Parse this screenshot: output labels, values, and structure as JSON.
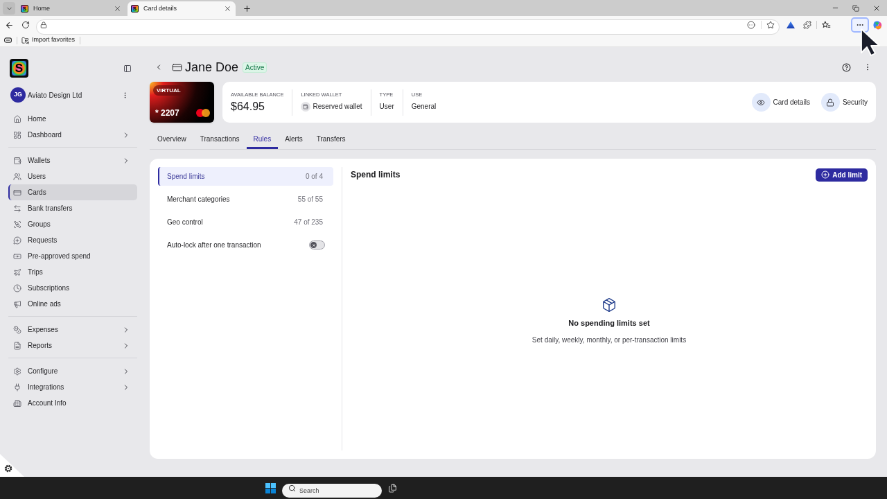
{
  "browser": {
    "tabs": [
      {
        "favicon": "S",
        "title": "Home",
        "selected": false
      },
      {
        "favicon": "S",
        "title": "Card details",
        "selected": true
      }
    ],
    "menu_button": {
      "highlighted": true
    },
    "favorites_bar": [
      {
        "label": "Import favorites"
      }
    ]
  },
  "sidebar": {
    "logo": "S",
    "account": {
      "initials": "JG",
      "name": "Aviato Design Ltd"
    },
    "groups": [
      {
        "items": [
          {
            "label": "Home",
            "selected": false,
            "has_submenu": false
          },
          {
            "label": "Dashboard",
            "selected": false,
            "has_submenu": true
          }
        ]
      },
      {
        "items": [
          {
            "label": "Wallets",
            "selected": false,
            "has_submenu": true
          },
          {
            "label": "Users",
            "selected": false,
            "has_submenu": false
          },
          {
            "label": "Cards",
            "selected": true,
            "has_submenu": false
          },
          {
            "label": "Bank transfers",
            "selected": false,
            "has_submenu": false
          },
          {
            "label": "Groups",
            "selected": false,
            "has_submenu": false
          },
          {
            "label": "Requests",
            "selected": false,
            "has_submenu": false
          },
          {
            "label": "Pre-approved spend",
            "selected": false,
            "has_submenu": false
          },
          {
            "label": "Trips",
            "selected": false,
            "has_submenu": false
          },
          {
            "label": "Subscriptions",
            "selected": false,
            "has_submenu": false
          },
          {
            "label": "Online ads",
            "selected": false,
            "has_submenu": false
          }
        ]
      },
      {
        "items": [
          {
            "label": "Expenses",
            "selected": false,
            "has_submenu": true
          },
          {
            "label": "Reports",
            "selected": false,
            "has_submenu": true
          }
        ]
      },
      {
        "items": [
          {
            "label": "Configure",
            "selected": false,
            "has_submenu": true
          },
          {
            "label": "Integrations",
            "selected": false,
            "has_submenu": true
          },
          {
            "label": "Account Info",
            "selected": false,
            "has_submenu": false
          }
        ]
      }
    ]
  },
  "header": {
    "title": "Jane Doe",
    "status": "Active"
  },
  "card": {
    "badge": "VIRTUAL",
    "number": "* 2207"
  },
  "summary": {
    "fields": [
      {
        "kind": "amount",
        "label": "AVAILABLE BALANCE",
        "value": "$64.95"
      },
      {
        "kind": "wallet",
        "label": "LINKED WALLET",
        "value": "Reserved wallet"
      },
      {
        "kind": "text",
        "label": "TYPE",
        "value": "User"
      },
      {
        "kind": "text",
        "label": "USE",
        "value": "General"
      }
    ],
    "actions": [
      {
        "label": "Card details"
      },
      {
        "label": "Security"
      }
    ]
  },
  "tabs": [
    {
      "label": "Overview",
      "selected": false
    },
    {
      "label": "Transactions",
      "selected": false
    },
    {
      "label": "Rules",
      "selected": true
    },
    {
      "label": "Alerts",
      "selected": false
    },
    {
      "label": "Transfers",
      "selected": false
    }
  ],
  "rules": {
    "items": [
      {
        "kind": "link",
        "label": "Spend limits",
        "count": "0 of 4",
        "selected": true
      },
      {
        "kind": "link",
        "label": "Merchant categories",
        "count": "55 of 55",
        "selected": false
      },
      {
        "kind": "link",
        "label": "Geo control",
        "count": "47 of 235",
        "selected": false
      },
      {
        "kind": "toggle",
        "label": "Auto-lock after one transaction",
        "on": false
      }
    ]
  },
  "panel": {
    "title": "Spend limits",
    "add_button": "Add limit",
    "empty_state": {
      "title": "No spending limits set",
      "subtitle": "Set daily, weekly, monthly, or per-transaction limits"
    }
  },
  "taskbar": {
    "search": {
      "placeholder": "Search"
    }
  }
}
